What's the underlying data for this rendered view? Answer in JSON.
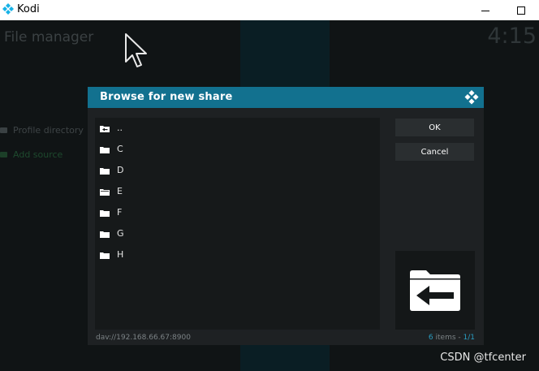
{
  "window": {
    "title": "Kodi",
    "icon": "kodi-logo-icon"
  },
  "background": {
    "title": "File manager",
    "clock": "4:15",
    "items": [
      {
        "label": "Profile directory",
        "icon": "folder-icon"
      },
      {
        "label": "Add source",
        "icon": "folder-icon"
      }
    ]
  },
  "dialog": {
    "title": "Browse for new share",
    "items": [
      {
        "label": "..",
        "icon": "folder-back-icon"
      },
      {
        "label": "C",
        "icon": "folder-icon"
      },
      {
        "label": "D",
        "icon": "folder-icon"
      },
      {
        "label": "E",
        "icon": "folder-open-icon"
      },
      {
        "label": "F",
        "icon": "folder-icon"
      },
      {
        "label": "G",
        "icon": "folder-icon"
      },
      {
        "label": "H",
        "icon": "folder-icon"
      }
    ],
    "ok_label": "OK",
    "cancel_label": "Cancel",
    "path": "dav://192.168.66.67:8900",
    "count_num": "6",
    "count_text": " items - ",
    "page": "1/1"
  },
  "watermark": "CSDN @tfcenter",
  "colors": {
    "header": "#12718f",
    "accent": "#2a9cc0",
    "dialog_bg": "#1e2123"
  }
}
